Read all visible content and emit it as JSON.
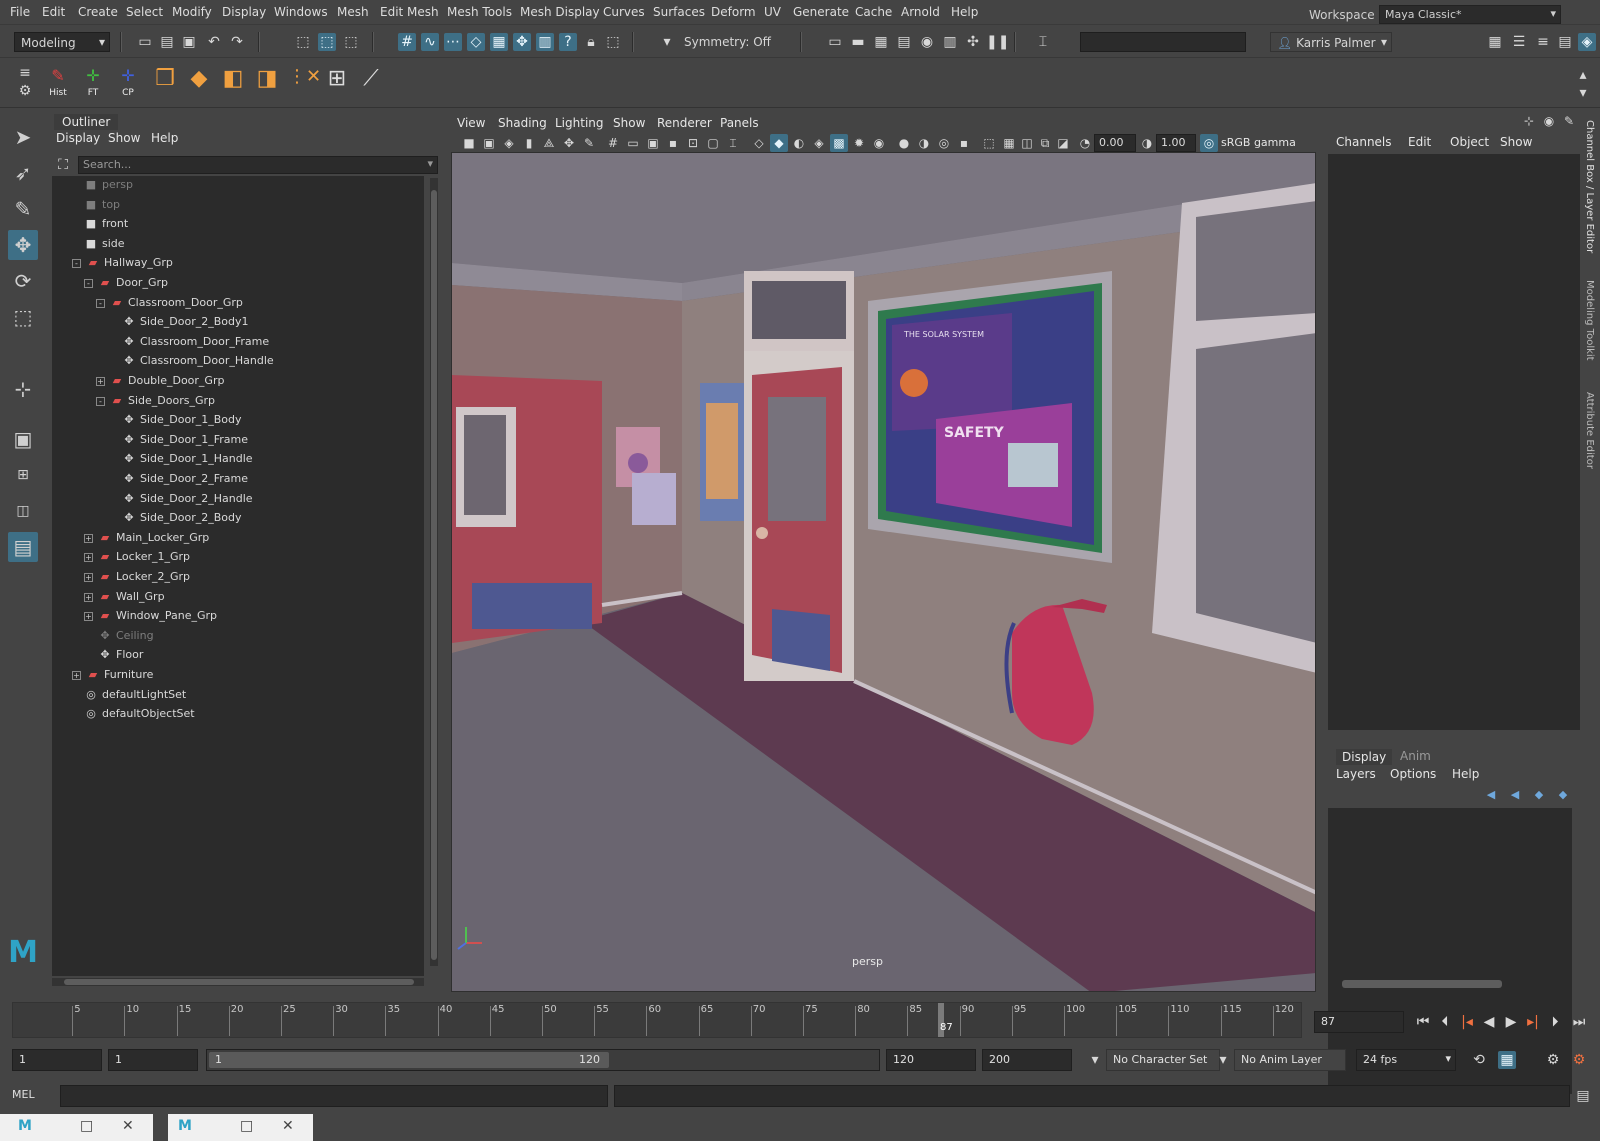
{
  "menubar": {
    "items": [
      "File",
      "Edit",
      "Create",
      "Select",
      "Modify",
      "Display",
      "Windows",
      "Mesh",
      "Edit Mesh",
      "Mesh Tools",
      "Mesh Display",
      "Curves",
      "Surfaces",
      "Deform",
      "UV",
      "Generate",
      "Cache",
      "Arnold",
      "Help"
    ],
    "workspace_label": "Workspace :",
    "workspace_value": "Maya Classic*"
  },
  "statusline": {
    "menuset": "Modeling",
    "symmetry": "Symmetry: Off",
    "user": "Karris Palmer"
  },
  "shelf": {
    "buttons": [
      {
        "label": "Hist",
        "icon": "history-icon"
      },
      {
        "label": "FT",
        "icon": "freeze-transform-icon"
      },
      {
        "label": "CP",
        "icon": "center-pivot-icon"
      }
    ]
  },
  "outliner": {
    "title": "Outliner",
    "menus": [
      "Display",
      "Show",
      "Help"
    ],
    "search_placeholder": "Search...",
    "rows": [
      {
        "label": "persp",
        "type": "camera",
        "depth": 1,
        "dim": true
      },
      {
        "label": "top",
        "type": "camera",
        "depth": 1,
        "dim": true
      },
      {
        "label": "front",
        "type": "camera",
        "depth": 1,
        "dim": false
      },
      {
        "label": "side",
        "type": "camera",
        "depth": 1,
        "dim": false
      },
      {
        "label": "Hallway_Grp",
        "type": "group",
        "depth": 0,
        "expander": "-",
        "dim": false
      },
      {
        "label": "Door_Grp",
        "type": "group",
        "depth": 1,
        "expander": "-",
        "dim": false
      },
      {
        "label": "Classroom_Door_Grp",
        "type": "group",
        "depth": 2,
        "expander": "-",
        "dim": false
      },
      {
        "label": "Side_Door_2_Body1",
        "type": "mesh",
        "depth": 3,
        "dim": false
      },
      {
        "label": "Classroom_Door_Frame",
        "type": "mesh",
        "depth": 3,
        "dim": false
      },
      {
        "label": "Classroom_Door_Handle",
        "type": "mesh",
        "depth": 3,
        "dim": false
      },
      {
        "label": "Double_Door_Grp",
        "type": "group",
        "depth": 2,
        "expander": "+",
        "dim": false
      },
      {
        "label": "Side_Doors_Grp",
        "type": "group",
        "depth": 2,
        "expander": "-",
        "dim": false
      },
      {
        "label": "Side_Door_1_Body",
        "type": "mesh",
        "depth": 3,
        "dim": false
      },
      {
        "label": "Side_Door_1_Frame",
        "type": "mesh",
        "depth": 3,
        "dim": false
      },
      {
        "label": "Side_Door_1_Handle",
        "type": "mesh",
        "depth": 3,
        "dim": false
      },
      {
        "label": "Side_Door_2_Frame",
        "type": "mesh",
        "depth": 3,
        "dim": false
      },
      {
        "label": "Side_Door_2_Handle",
        "type": "mesh",
        "depth": 3,
        "dim": false
      },
      {
        "label": "Side_Door_2_Body",
        "type": "mesh",
        "depth": 3,
        "dim": false
      },
      {
        "label": "Main_Locker_Grp",
        "type": "group",
        "depth": 1,
        "expander": "+",
        "dim": false
      },
      {
        "label": "Locker_1_Grp",
        "type": "group",
        "depth": 1,
        "expander": "+",
        "dim": false
      },
      {
        "label": "Locker_2_Grp",
        "type": "group",
        "depth": 1,
        "expander": "+",
        "dim": false
      },
      {
        "label": "Wall_Grp",
        "type": "group",
        "depth": 1,
        "expander": "+",
        "dim": false
      },
      {
        "label": "Window_Pane_Grp",
        "type": "group",
        "depth": 1,
        "expander": "+",
        "dim": false
      },
      {
        "label": "Ceiling",
        "type": "mesh",
        "depth": 1,
        "dim": true
      },
      {
        "label": "Floor",
        "type": "mesh",
        "depth": 1,
        "dim": false
      },
      {
        "label": "Furniture",
        "type": "group",
        "depth": 0,
        "expander": "+",
        "dim": false
      },
      {
        "label": "defaultLightSet",
        "type": "set",
        "depth": 0,
        "dim": false
      },
      {
        "label": "defaultObjectSet",
        "type": "set",
        "depth": 0,
        "dim": false
      }
    ]
  },
  "viewport": {
    "menus": [
      "View",
      "Shading",
      "Lighting",
      "Show",
      "Renderer",
      "Panels"
    ],
    "exposure": "0.00",
    "gamma": "1.00",
    "colorspace": "sRGB gamma",
    "camera_label": "persp",
    "poster_solar": "THE SOLAR SYSTEM",
    "poster_safety": "SAFETY"
  },
  "channelbox": {
    "menus": [
      "Channels",
      "Edit",
      "Object",
      "Show"
    ],
    "side_tabs": [
      "Channel Box / Layer Editor",
      "Modeling Toolkit",
      "Attribute Editor"
    ],
    "layer_tabs": [
      "Display",
      "Anim"
    ],
    "layer_menus": [
      "Layers",
      "Options",
      "Help"
    ]
  },
  "timeline": {
    "ticks": [
      "5",
      "10",
      "15",
      "20",
      "25",
      "30",
      "35",
      "40",
      "45",
      "50",
      "55",
      "60",
      "65",
      "70",
      "75",
      "80",
      "85",
      "90",
      "95",
      "100",
      "105",
      "110",
      "115",
      "120"
    ],
    "current_frame": "87",
    "current_frame_field": "87"
  },
  "range": {
    "start": "1",
    "playback_start": "1",
    "slider_start": "1",
    "slider_end": "120",
    "playback_end": "120",
    "end": "200",
    "character_set": "No Character Set",
    "anim_layer": "No Anim Layer",
    "fps": "24 fps"
  },
  "commandline": {
    "label": "MEL"
  },
  "colors": {
    "accent": "#3e6f86",
    "panel_bg": "#444444",
    "field_bg": "#2b2b2b"
  }
}
